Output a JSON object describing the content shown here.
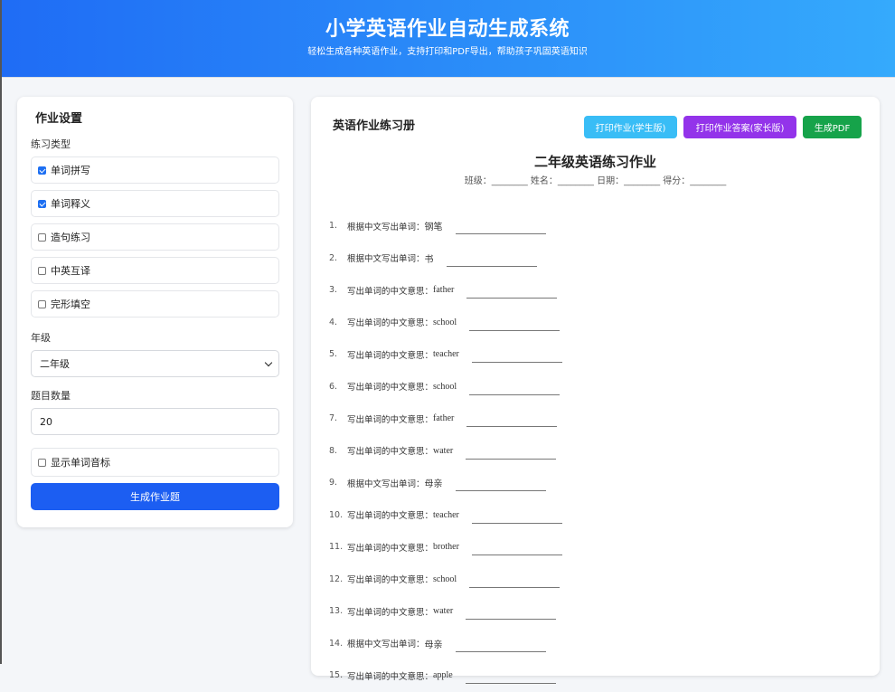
{
  "header": {
    "title": "小学英语作业自动生成系统",
    "subtitle": "轻松生成各种英语作业，支持打印和PDF导出，帮助孩子巩固英语知识"
  },
  "settings": {
    "title": "作业设置",
    "type_label": "练习类型",
    "options": [
      {
        "label": "单词拼写",
        "checked": true
      },
      {
        "label": "单词释义",
        "checked": true
      },
      {
        "label": "造句练习",
        "checked": false
      },
      {
        "label": "中英互译",
        "checked": false
      },
      {
        "label": "完形填空",
        "checked": false
      }
    ],
    "grade_label": "年级",
    "grade_value": "二年级",
    "count_label": "题目数量",
    "count_value": "20",
    "phonetic_label": "显示单词音标",
    "phonetic_checked": false,
    "generate_label": "生成作业题"
  },
  "workbook": {
    "title": "英语作业练习册",
    "print_student_label": "打印作业(学生版)",
    "print_answer_label": "打印作业答案(家长版)",
    "pdf_label": "生成PDF",
    "sheet_title": "二年级英语练习作业",
    "info_line": "班级：________ 姓名：________ 日期：________ 得分：________",
    "questions": [
      {
        "num": "1.",
        "prompt": "根据中文写出单词：",
        "word": "钢笔"
      },
      {
        "num": "2.",
        "prompt": "根据中文写出单词：",
        "word": "书"
      },
      {
        "num": "3.",
        "prompt": "写出单词的中文意思：",
        "word": "father"
      },
      {
        "num": "4.",
        "prompt": "写出单词的中文意思：",
        "word": "school"
      },
      {
        "num": "5.",
        "prompt": "写出单词的中文意思：",
        "word": "teacher"
      },
      {
        "num": "6.",
        "prompt": "写出单词的中文意思：",
        "word": "school"
      },
      {
        "num": "7.",
        "prompt": "写出单词的中文意思：",
        "word": "father"
      },
      {
        "num": "8.",
        "prompt": "写出单词的中文意思：",
        "word": "water"
      },
      {
        "num": "9.",
        "prompt": "根据中文写出单词：",
        "word": "母亲"
      },
      {
        "num": "10.",
        "prompt": "写出单词的中文意思：",
        "word": "teacher"
      },
      {
        "num": "11.",
        "prompt": "写出单词的中文意思：",
        "word": "brother"
      },
      {
        "num": "12.",
        "prompt": "写出单词的中文意思：",
        "word": "school"
      },
      {
        "num": "13.",
        "prompt": "写出单词的中文意思：",
        "word": "water"
      },
      {
        "num": "14.",
        "prompt": "根据中文写出单词：",
        "word": "母亲"
      },
      {
        "num": "15.",
        "prompt": "写出单词的中文意思：",
        "word": "apple"
      }
    ]
  },
  "colors": {
    "header_start": "#1f6cf5",
    "header_end": "#35aafc",
    "generate_button": "#1c5ef2",
    "print_student_button": "#39bdf6",
    "print_answer_button": "#9333ea",
    "pdf_button": "#16a34a"
  }
}
